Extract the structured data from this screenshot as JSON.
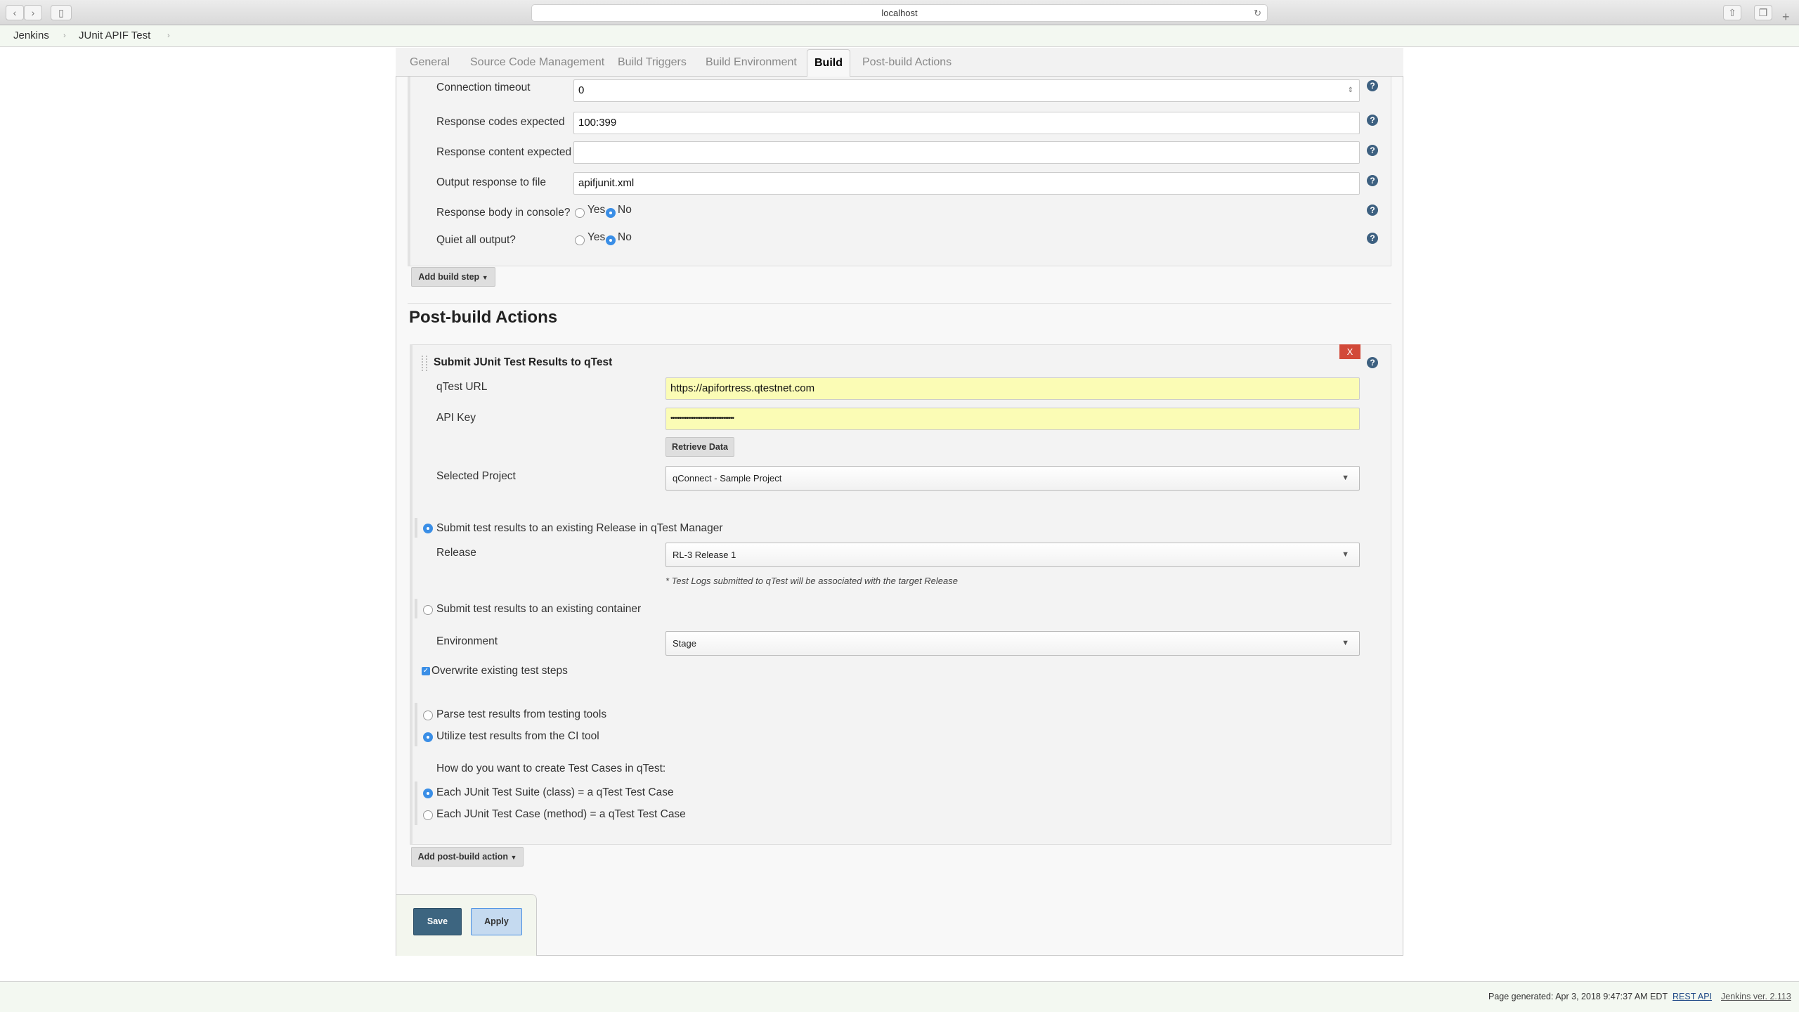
{
  "browser": {
    "url": "localhost"
  },
  "breadcrumb": [
    "Jenkins",
    "JUnit APIF Test"
  ],
  "tabs": [
    "General",
    "Source Code Management",
    "Build Triggers",
    "Build Environment",
    "Build",
    "Post-build Actions"
  ],
  "active_tab": "Build",
  "build": {
    "fields": [
      {
        "label": "Connection timeout",
        "value": "0"
      },
      {
        "label": "Response codes expected",
        "value": "100:399"
      },
      {
        "label": "Response content expected",
        "value": ""
      },
      {
        "label": "Output response to file",
        "value": "apifjunit.xml"
      }
    ],
    "radios": [
      {
        "label": "Response body in console?",
        "yes": "Yes",
        "no": "No",
        "selected": "No"
      },
      {
        "label": "Quiet all output?",
        "yes": "Yes",
        "no": "No",
        "selected": "No"
      }
    ],
    "add_step": "Add build step"
  },
  "post": {
    "heading": "Post-build Actions",
    "delete": "X",
    "title": "Submit JUnit Test Results to qTest",
    "url_label": "qTest URL",
    "url_value": "https://apifortress.qtestnet.com",
    "key_label": "API Key",
    "key_value": "••••••••••••••••••••••••••••••••••••",
    "retrieve": "Retrieve Data",
    "project_label": "Selected Project",
    "project_value": "qConnect - Sample Project",
    "opt_release": "Submit test results to an existing Release in qTest Manager",
    "release_label": "Release",
    "release_value": "RL-3 Release 1",
    "release_note": "* Test Logs submitted to qTest will be associated with the target Release",
    "opt_container": "Submit test results to an existing container",
    "env_label": "Environment",
    "env_value": "Stage",
    "overwrite": "Overwrite existing test steps",
    "overwrite_checked": true,
    "opt_parse": "Parse test results from testing tools",
    "opt_utilize": "Utilize test results from the CI tool",
    "how_label": "How do you want to create Test Cases in qTest:",
    "opt_suite": "Each JUnit Test Suite (class) = a qTest Test Case",
    "opt_case": "Each JUnit Test Case (method) = a qTest Test Case",
    "add_action": "Add post-build action"
  },
  "save": "Save",
  "apply": "Apply",
  "footer": {
    "generated": "Page generated: Apr 3, 2018 9:47:37 AM EDT",
    "rest": "REST API",
    "version": "Jenkins ver. 2.113"
  },
  "colors": {
    "accent": "#3a8ee6",
    "save": "#3d6580",
    "apply": "#c5daf0",
    "delete": "#d24939",
    "autofill": "#fbfcb5"
  }
}
